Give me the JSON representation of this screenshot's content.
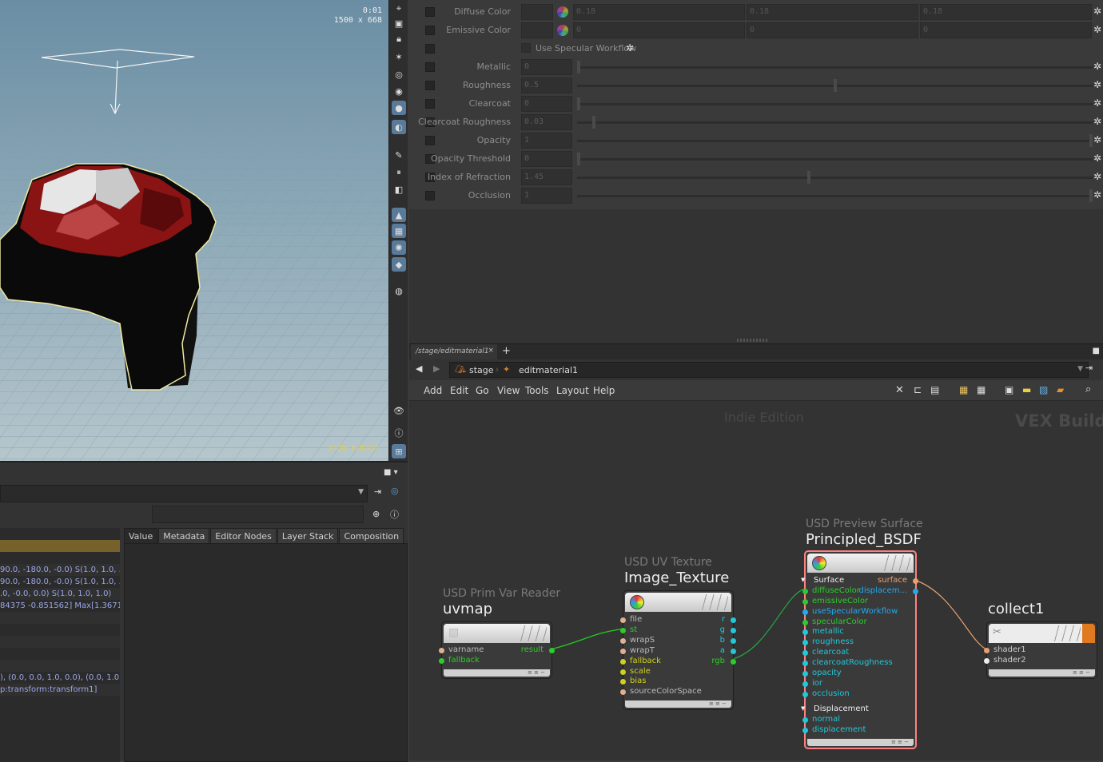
{
  "viewport": {
    "time": "0:01",
    "resolution": "1500 x 668",
    "watermark": "Indie Edition"
  },
  "scene_graph": {
    "rows": [
      "",
      "",
      "",
      "90.0, -180.0, -0.0) S(1.0, 1.0, ...",
      "90.0, -180.0, -0.0) S(1.0, 1.0, ...",
      ".0, -0.0, 0.0) S(1.0, 1.0, 1.0)",
      "84375 -0.851562] Max[1.3671...",
      "",
      "",
      "",
      "",
      "",
      "), (0.0, 0.0, 1.0, 0.0), (0.0, 1.0,...",
      "p:transform:transform1]"
    ],
    "tabs": [
      "Value",
      "Metadata",
      "Editor Nodes",
      "Layer Stack",
      "Composition"
    ],
    "active_tab": "Value"
  },
  "parameters": {
    "diffuse": {
      "label": "Diffuse Color",
      "values": [
        "0.18",
        "0.18",
        "0.18"
      ]
    },
    "emissive": {
      "label": "Emissive Color",
      "values": [
        "0",
        "0",
        "0"
      ]
    },
    "specular_workflow": {
      "label": "Use Specular Workflow"
    },
    "sliders": [
      {
        "label": "Metallic",
        "value": "0",
        "level": 0.0
      },
      {
        "label": "Roughness",
        "value": "0.5",
        "level": 0.5
      },
      {
        "label": "Clearcoat",
        "value": "0",
        "level": 0.0
      },
      {
        "label": "Clearcoat Roughness",
        "value": "0.03",
        "level": 0.03
      },
      {
        "label": "Opacity",
        "value": "1",
        "level": 1.0
      },
      {
        "label": "Opacity Threshold",
        "value": "0",
        "level": 0.0
      },
      {
        "label": "Index of Refraction",
        "value": "1.45",
        "level": 0.45
      },
      {
        "label": "Occlusion",
        "value": "1",
        "level": 1.0
      }
    ]
  },
  "network": {
    "tab_label": "/stage/editmaterial1",
    "path": [
      "stage",
      "editmaterial1"
    ],
    "menu": [
      "Add",
      "Edit",
      "Go",
      "View",
      "Tools",
      "Layout",
      "Help"
    ],
    "watermark": "Indie Edition",
    "context_label": "VEX Builder",
    "nodes": {
      "uvmap": {
        "type": "USD Prim Var Reader",
        "name": "uvmap",
        "inputs": [
          "varname",
          "fallback"
        ],
        "outputs": [
          "result"
        ]
      },
      "image_texture": {
        "type": "USD UV Texture",
        "name": "Image_Texture",
        "inputs": [
          "file",
          "st",
          "wrapS",
          "wrapT",
          "fallback",
          "scale",
          "bias",
          "sourceColorSpace"
        ],
        "outputs": [
          "r",
          "g",
          "b",
          "a",
          "rgb"
        ]
      },
      "principled": {
        "type": "USD Preview Surface",
        "name": "Principled_BSDF",
        "surface_section": "Surface",
        "surface_inputs": [
          "diffuseColor",
          "emissiveColor",
          "useSpecularWorkflow",
          "specularColor",
          "metallic",
          "roughness",
          "clearcoat",
          "clearcoatRoughness",
          "opacity",
          "ior",
          "occlusion"
        ],
        "displacement_section": "Displacement",
        "displacement_inputs": [
          "normal",
          "displacement"
        ],
        "outputs": [
          "surface",
          "displacem..."
        ]
      },
      "collect": {
        "name": "collect1",
        "inputs": [
          "shader1",
          "shader2"
        ]
      }
    }
  },
  "colors": {
    "wire_green": "#22cc22",
    "wire_orange": "#e8a070",
    "port_cyan": "#22c8d8",
    "port_green": "#2ccc2c",
    "port_yellow": "#d0d020",
    "port_peach": "#e0b090",
    "selection_red": "#ff8080"
  }
}
